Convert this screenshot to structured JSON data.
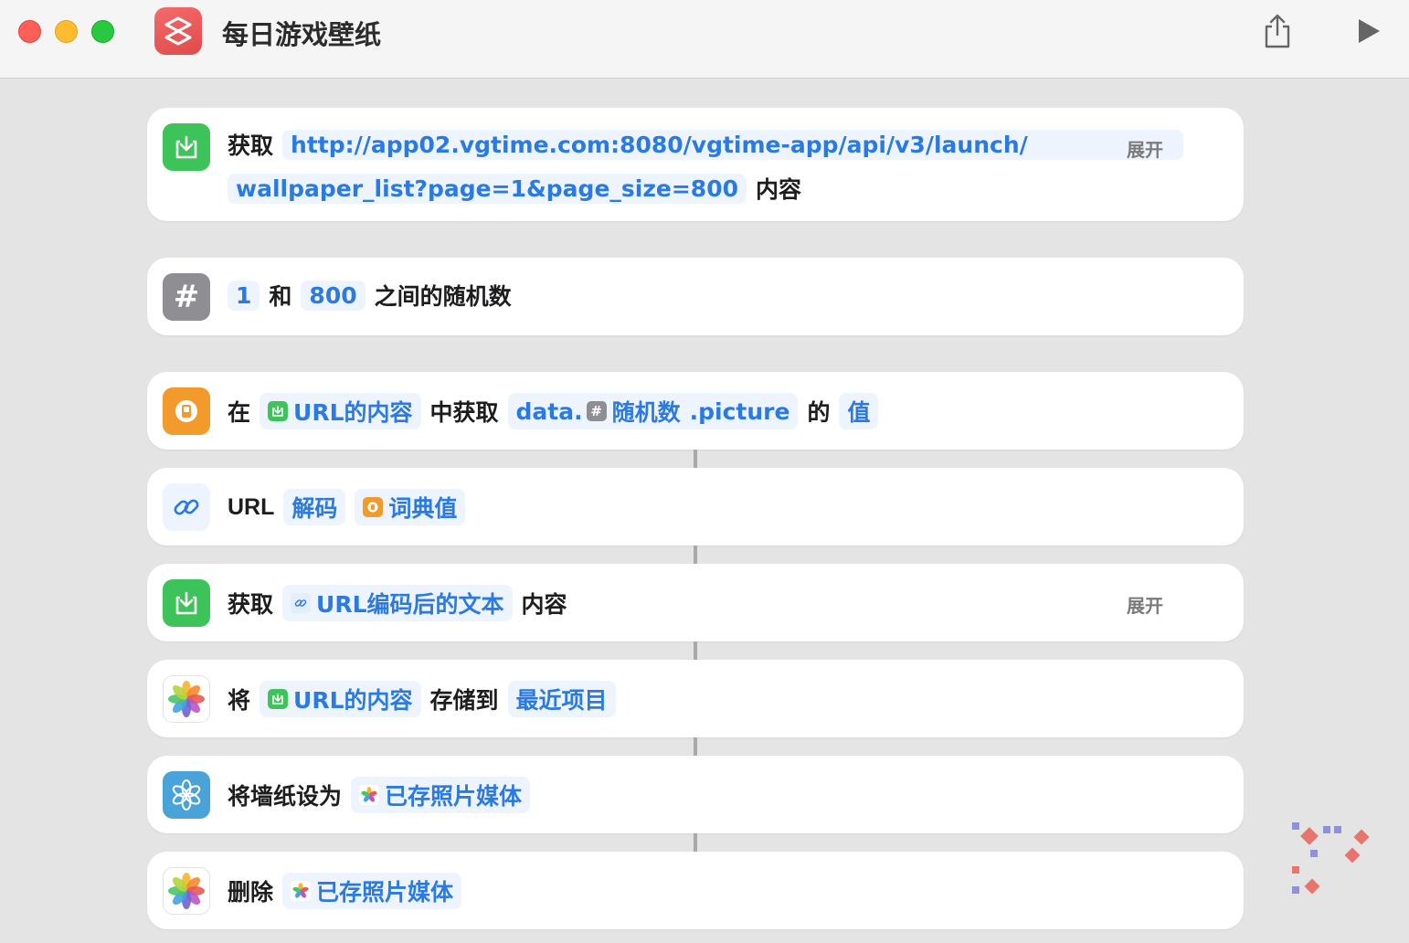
{
  "window": {
    "title": "每日游戏壁纸"
  },
  "actions": [
    {
      "verb": "获取",
      "url_line1": "http://app02.vgtime.com:8080/vgtime-app/api/v3/launch/",
      "url_line2": "wallpaper_list?page=1&page_size=800",
      "suffix": "内容",
      "expand": "展开"
    },
    {
      "min": "1",
      "and": "和",
      "max": "800",
      "suffix": "之间的随机数"
    },
    {
      "prefix": "在",
      "source": "URL的内容",
      "mid": "中获取",
      "key_prefix": "data.",
      "key_var": "随机数",
      "key_suffix": ".picture",
      "of": "的",
      "result": "值"
    },
    {
      "prefix": "URL",
      "mode": "解码",
      "input": "词典值"
    },
    {
      "verb": "获取",
      "input": "URL编码后的文本",
      "suffix": "内容",
      "expand": "展开"
    },
    {
      "prefix": "将",
      "input": "URL的内容",
      "mid": "存储到",
      "album": "最近项目"
    },
    {
      "prefix": "将墙纸设为",
      "input": "已存照片媒体"
    },
    {
      "prefix": "删除",
      "input": "已存照片媒体"
    }
  ],
  "colors": {
    "accent": "#2a7ae2",
    "token_bg": "#eef4fe",
    "green": "#3ec35a",
    "orange": "#f39a2c",
    "gray": "#8e8e93",
    "teal": "#4aa3d8"
  }
}
